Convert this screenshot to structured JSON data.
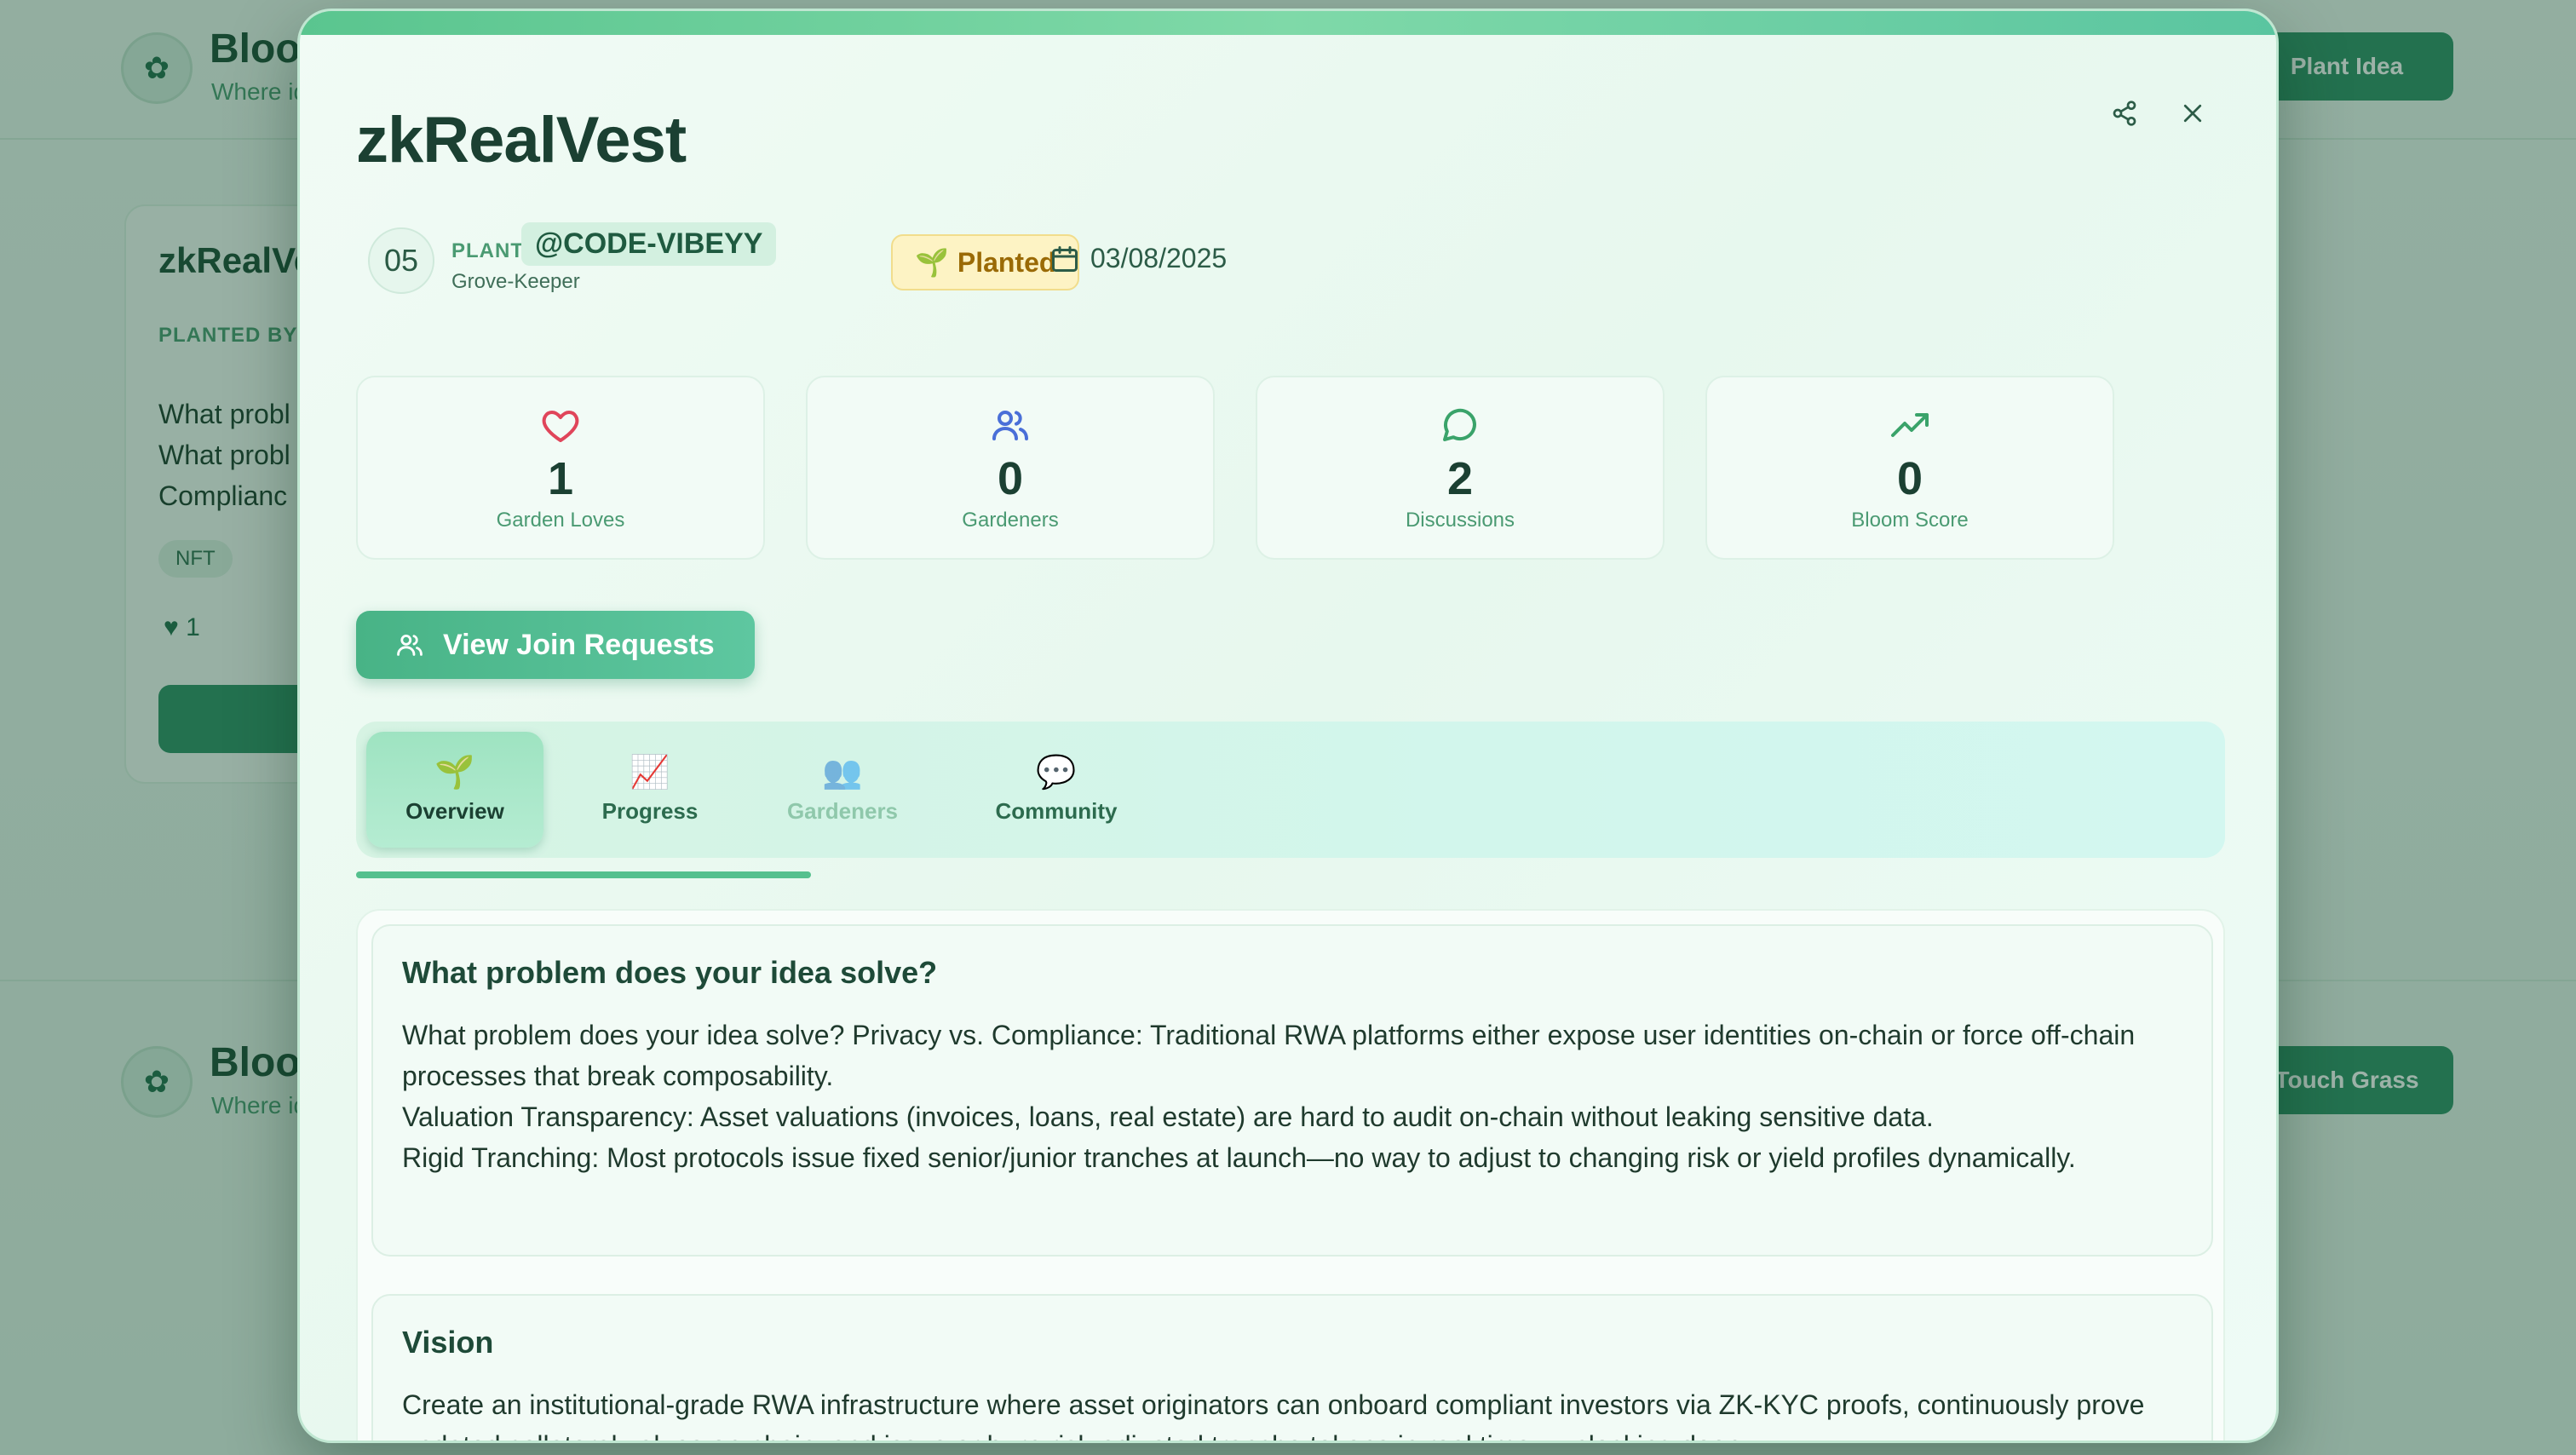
{
  "background": {
    "brand": "Bloom",
    "tagline": "Where ideas grow",
    "top_button": "Plant Idea",
    "bottom_button": "Touch Grass",
    "card": {
      "title": "zkRealVest",
      "planted_by": "PLANTED BY",
      "text_lines": [
        "What probl",
        "What probl",
        "Complianc"
      ],
      "tag": "NFT",
      "likes": "1"
    }
  },
  "modal": {
    "title": "zkRealVest",
    "owner": {
      "number": "05",
      "planted_by_label": "PLANTED BY",
      "handle": "@CODE-VIBEYY",
      "role": "Grove-Keeper"
    },
    "status": "Planted",
    "date": "03/08/2025",
    "stats": [
      {
        "value": "1",
        "label": "Garden Loves",
        "icon": "heart-icon",
        "color": "#e0455a"
      },
      {
        "value": "0",
        "label": "Gardeners",
        "icon": "users-icon",
        "color": "#4a6fd8"
      },
      {
        "value": "2",
        "label": "Discussions",
        "icon": "chat-icon",
        "color": "#3aa36a"
      },
      {
        "value": "0",
        "label": "Bloom Score",
        "icon": "trending-up-icon",
        "color": "#3aa36a"
      }
    ],
    "join_button": "View Join Requests",
    "tabs": [
      {
        "label": "Overview",
        "emoji": "🌱"
      },
      {
        "label": "Progress",
        "emoji": "📈"
      },
      {
        "label": "Gardeners",
        "emoji": "👥"
      },
      {
        "label": "Community",
        "emoji": "💬"
      }
    ],
    "sections": [
      {
        "heading": "What problem does your idea solve?",
        "lines": [
          "What problem does your idea solve? Privacy vs. Compliance: Traditional RWA platforms either expose user identities on-chain or force off-chain processes that break composability.",
          "Valuation Transparency: Asset valuations (invoices, loans, real estate) are hard to audit on-chain without leaking sensitive data.",
          "Rigid Tranching: Most protocols issue fixed senior/junior tranches at launch—no way to adjust to changing risk or yield profiles dynamically."
        ]
      },
      {
        "heading": "Vision",
        "lines": [
          "Create an institutional-grade RWA infrastructure where asset originators can onboard compliant investors via ZK-KYC proofs, continuously prove updated collateral values on-chain, and issue or burn risk-adjusted tranche tokens in real time—unlocking deep"
        ]
      }
    ]
  }
}
